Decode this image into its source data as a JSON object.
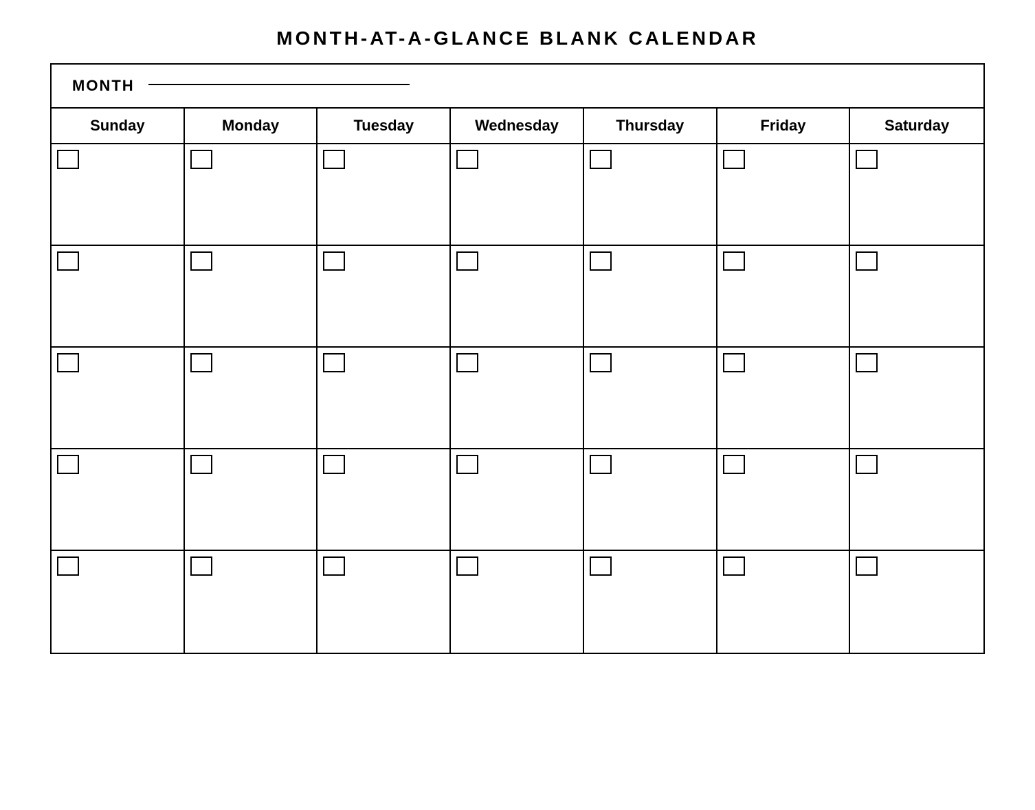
{
  "title": "MONTH-AT-A-GLANCE  BLANK  CALENDAR",
  "month_label": "MONTH",
  "days": [
    "Sunday",
    "Monday",
    "Tuesday",
    "Wednesday",
    "Thursday",
    "Friday",
    "Saturday"
  ],
  "rows": 5,
  "cols": 7
}
